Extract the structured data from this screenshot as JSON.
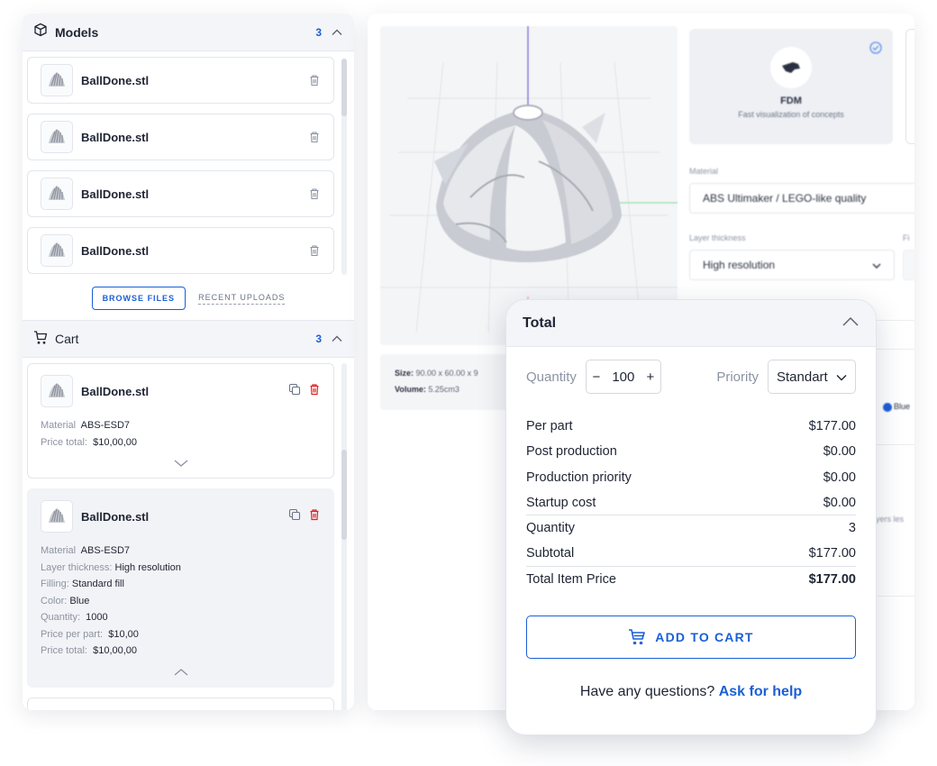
{
  "models": {
    "title": "Models",
    "count": "3",
    "files": [
      {
        "name": "BallDone.stl"
      },
      {
        "name": "BallDone.stl"
      },
      {
        "name": "BallDone.stl"
      },
      {
        "name": "BallDone.stl"
      }
    ],
    "browse_label": "BROWSE FILES",
    "recent_label": "RECENT UPLOADS"
  },
  "cart": {
    "title": "Cart",
    "count": "3",
    "items": [
      {
        "name": "BallDone.stl",
        "material_key": "Material",
        "material": "ABS-ESD7",
        "price_total_key": "Price total:",
        "price_total": "$10,00,00"
      },
      {
        "name": "BallDone.stl",
        "material_key": "Material",
        "material": "ABS-ESD7",
        "layer_key": "Layer thickness:",
        "layer": "High resolution",
        "filling_key": "Filling:",
        "filling": "Standard fill",
        "color_key": "Color:",
        "color": "Blue",
        "quantity_key": "Quantity:",
        "quantity": "1000",
        "ppp_key": "Price per part:",
        "ppp": "$10,00",
        "price_total_key": "Price total:",
        "price_total": "$10,00,00"
      }
    ]
  },
  "viewer": {
    "size_key": "Size:",
    "size": "90.00 x 60.00 x 9",
    "volume_key": "Volume:",
    "volume": "5.25cm3"
  },
  "tech": {
    "name": "FDM",
    "desc": "Fast visualization of concepts"
  },
  "config": {
    "material_label": "Material",
    "material_value": "ABS Ultimaker / LEGO-like quality",
    "layer_label": "Layer thickness",
    "layer_value": "High resolution",
    "fill_label_partial": "Fi",
    "color_partial": "Blue",
    "layers_partial": "yers les"
  },
  "total": {
    "title": "Total",
    "quantity_label": "Quantity",
    "quantity_value": "100",
    "minus": "−",
    "plus": "+",
    "priority_label": "Priority",
    "priority_value": "Standart",
    "lines": [
      {
        "label": "Per part",
        "value": "$177.00"
      },
      {
        "label": "Post production",
        "value": "$0.00"
      },
      {
        "label": "Production priority",
        "value": "$0.00"
      },
      {
        "label": "Startup cost",
        "value": "$0.00"
      },
      {
        "label": "Quantity",
        "value": "3"
      },
      {
        "label": "Subtotal",
        "value": "$177.00"
      },
      {
        "label": "Total Item Price",
        "value": "$177.00"
      }
    ],
    "add_to_cart": "ADD TO CART",
    "help_text": "Have any questions?",
    "help_link": "Ask for help"
  },
  "colors": {
    "accent": "#1a5fd6",
    "danger": "#e02424",
    "panel_bg": "#f4f5f8"
  }
}
